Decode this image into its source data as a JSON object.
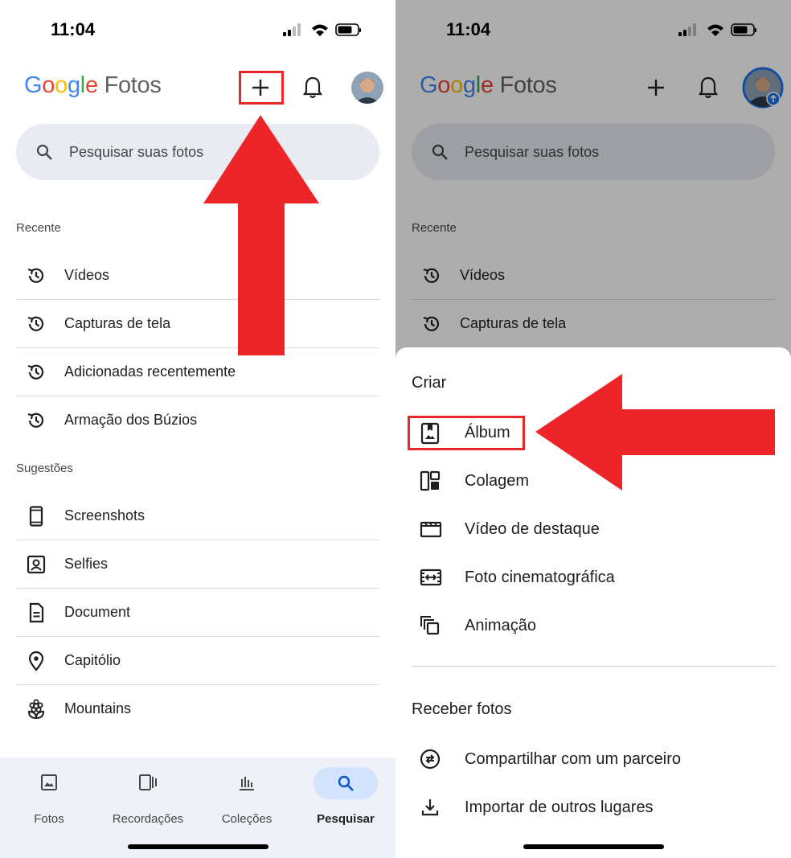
{
  "status": {
    "time": "11:04"
  },
  "app": {
    "logo_google": "Google",
    "logo_fotos": "Fotos"
  },
  "search": {
    "placeholder": "Pesquisar suas fotos"
  },
  "recent": {
    "heading": "Recente",
    "items": [
      {
        "label": "Vídeos",
        "icon": "history-icon"
      },
      {
        "label": "Capturas de tela",
        "icon": "history-icon"
      },
      {
        "label": "Adicionadas recentemente",
        "icon": "history-icon"
      },
      {
        "label": "Armação dos Búzios",
        "icon": "history-icon"
      }
    ]
  },
  "suggestions": {
    "heading": "Sugestões",
    "items": [
      {
        "label": "Screenshots",
        "icon": "phone-icon"
      },
      {
        "label": "Selfies",
        "icon": "portrait-icon"
      },
      {
        "label": "Document",
        "icon": "document-icon"
      },
      {
        "label": "Capitólio",
        "icon": "location-pin-icon"
      },
      {
        "label": "Mountains",
        "icon": "flower-icon"
      }
    ]
  },
  "bottom_nav": [
    {
      "label": "Fotos",
      "icon": "photo-icon"
    },
    {
      "label": "Recordações",
      "icon": "memories-icon"
    },
    {
      "label": "Coleções",
      "icon": "library-icon"
    },
    {
      "label": "Pesquisar",
      "icon": "search-icon",
      "active": true
    }
  ],
  "sheet": {
    "create_title": "Criar",
    "create_items": [
      {
        "label": "Álbum",
        "icon": "album-icon"
      },
      {
        "label": "Colagem",
        "icon": "collage-icon"
      },
      {
        "label": "Vídeo de destaque",
        "icon": "movie-icon"
      },
      {
        "label": "Foto cinematográfica",
        "icon": "cinematic-icon"
      },
      {
        "label": "Animação",
        "icon": "animation-icon"
      }
    ],
    "receive_title": "Receber fotos",
    "receive_items": [
      {
        "label": "Compartilhar com um parceiro",
        "icon": "partner-share-icon"
      },
      {
        "label": "Importar de outros lugares",
        "icon": "download-icon"
      }
    ]
  },
  "colors": {
    "annotation_red": "#ee2528",
    "search_bg": "#e8ebf2",
    "nav_active": "#d3e3fd"
  }
}
